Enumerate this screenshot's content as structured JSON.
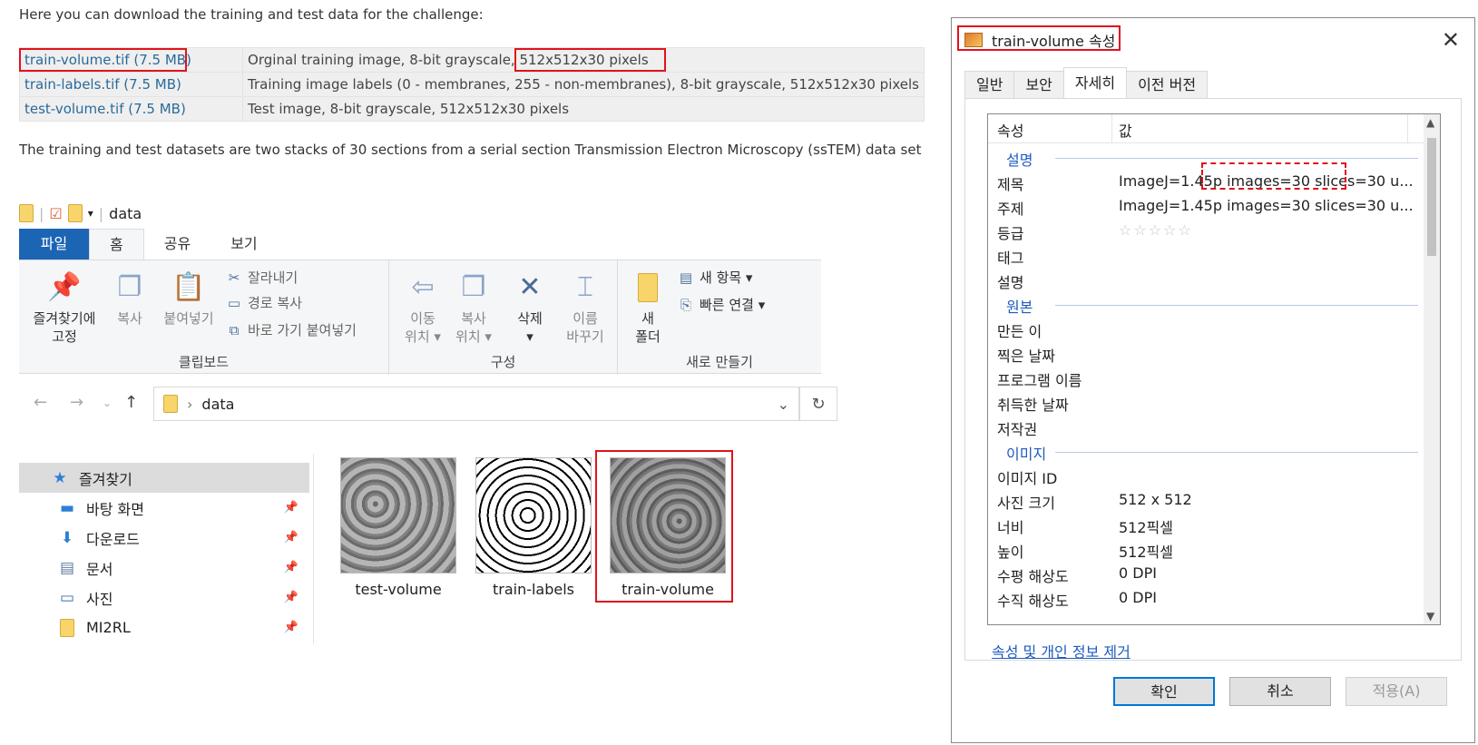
{
  "web": {
    "intro": "Here you can download the training and test data for the challenge:",
    "table": [
      {
        "file": "train-volume.tif (7.5 MB)",
        "desc": "Orginal training image, 8-bit grayscale, 512x512x30 pixels"
      },
      {
        "file": "train-labels.tif (7.5 MB)",
        "desc": "Training image labels (0 - membranes, 255 - non-membranes), 8-bit grayscale, 512x512x30 pixels"
      },
      {
        "file": "test-volume.tif (7.5 MB)",
        "desc": "Test image, 8-bit grayscale, 512x512x30 pixels"
      }
    ],
    "body": "The training and test datasets are two stacks of 30 sections from a serial section Transmission Electron Microscopy (ssTEM) data set of the"
  },
  "explorer": {
    "quick_access_title": "data",
    "tabs": [
      "파일",
      "홈",
      "공유",
      "보기"
    ],
    "ribbon": {
      "pin": "즐겨찾기에\n고정",
      "copy": "복사",
      "paste": "붙여넣기",
      "cut": "잘라내기",
      "copy_path": "경로 복사",
      "paste_shortcut": "바로 가기 붙여넣기",
      "clipboard_group": "클립보드",
      "move": "이동\n위치 ▾",
      "copy_to": "복사\n위치 ▾",
      "delete": "삭제\n▾",
      "rename": "이름\n바꾸기",
      "organize_group": "구성",
      "new_folder": "새\n폴더",
      "new_item": "새 항목 ▾",
      "easy_access": "빠른 연결 ▾",
      "new_group": "새로 만들기"
    },
    "address": "data",
    "nav": [
      {
        "label": "즐겨찾기",
        "icon": "star-icon",
        "pinned": false,
        "selected": true
      },
      {
        "label": "바탕 화면",
        "icon": "desktop-icon",
        "pinned": true
      },
      {
        "label": "다운로드",
        "icon": "download-icon",
        "pinned": true
      },
      {
        "label": "문서",
        "icon": "document-icon",
        "pinned": true
      },
      {
        "label": "사진",
        "icon": "pictures-icon",
        "pinned": true
      },
      {
        "label": "MI2RL",
        "icon": "folder-icon",
        "pinned": true
      }
    ],
    "files": [
      "test-volume",
      "train-labels",
      "train-volume"
    ]
  },
  "dialog": {
    "title": "train-volume 속성",
    "tabs": [
      "일반",
      "보안",
      "자세히",
      "이전 버전"
    ],
    "active_tab": "자세히",
    "col_key": "속성",
    "col_val": "값",
    "rows": [
      {
        "type": "section",
        "k": "설명"
      },
      {
        "k": "제목",
        "v": "ImageJ=1.45p images=30 slices=30 u..."
      },
      {
        "k": "주제",
        "v": "ImageJ=1.45p images=30 slices=30 u..."
      },
      {
        "k": "등급",
        "v": "☆☆☆☆☆",
        "stars": true
      },
      {
        "k": "태그",
        "v": ""
      },
      {
        "k": "설명",
        "v": ""
      },
      {
        "type": "section",
        "k": "원본"
      },
      {
        "k": "만든 이",
        "v": ""
      },
      {
        "k": "찍은 날짜",
        "v": ""
      },
      {
        "k": "프로그램 이름",
        "v": ""
      },
      {
        "k": "취득한 날짜",
        "v": ""
      },
      {
        "k": "저작권",
        "v": ""
      },
      {
        "type": "section",
        "k": "이미지"
      },
      {
        "k": "이미지 ID",
        "v": ""
      },
      {
        "k": "사진 크기",
        "v": "512 x 512"
      },
      {
        "k": "너비",
        "v": "512픽셀"
      },
      {
        "k": "높이",
        "v": "512픽셀"
      },
      {
        "k": "수평 해상도",
        "v": "0 DPI"
      },
      {
        "k": "수직 해상도",
        "v": "0 DPI"
      }
    ],
    "remove_link": "속성 및 개인 정보 제거",
    "ok": "확인",
    "cancel": "취소",
    "apply": "적용(A)"
  },
  "colors": {
    "highlight": "#e0131b",
    "file_tab": "#1c64b4",
    "link": "#1d5bbf"
  }
}
